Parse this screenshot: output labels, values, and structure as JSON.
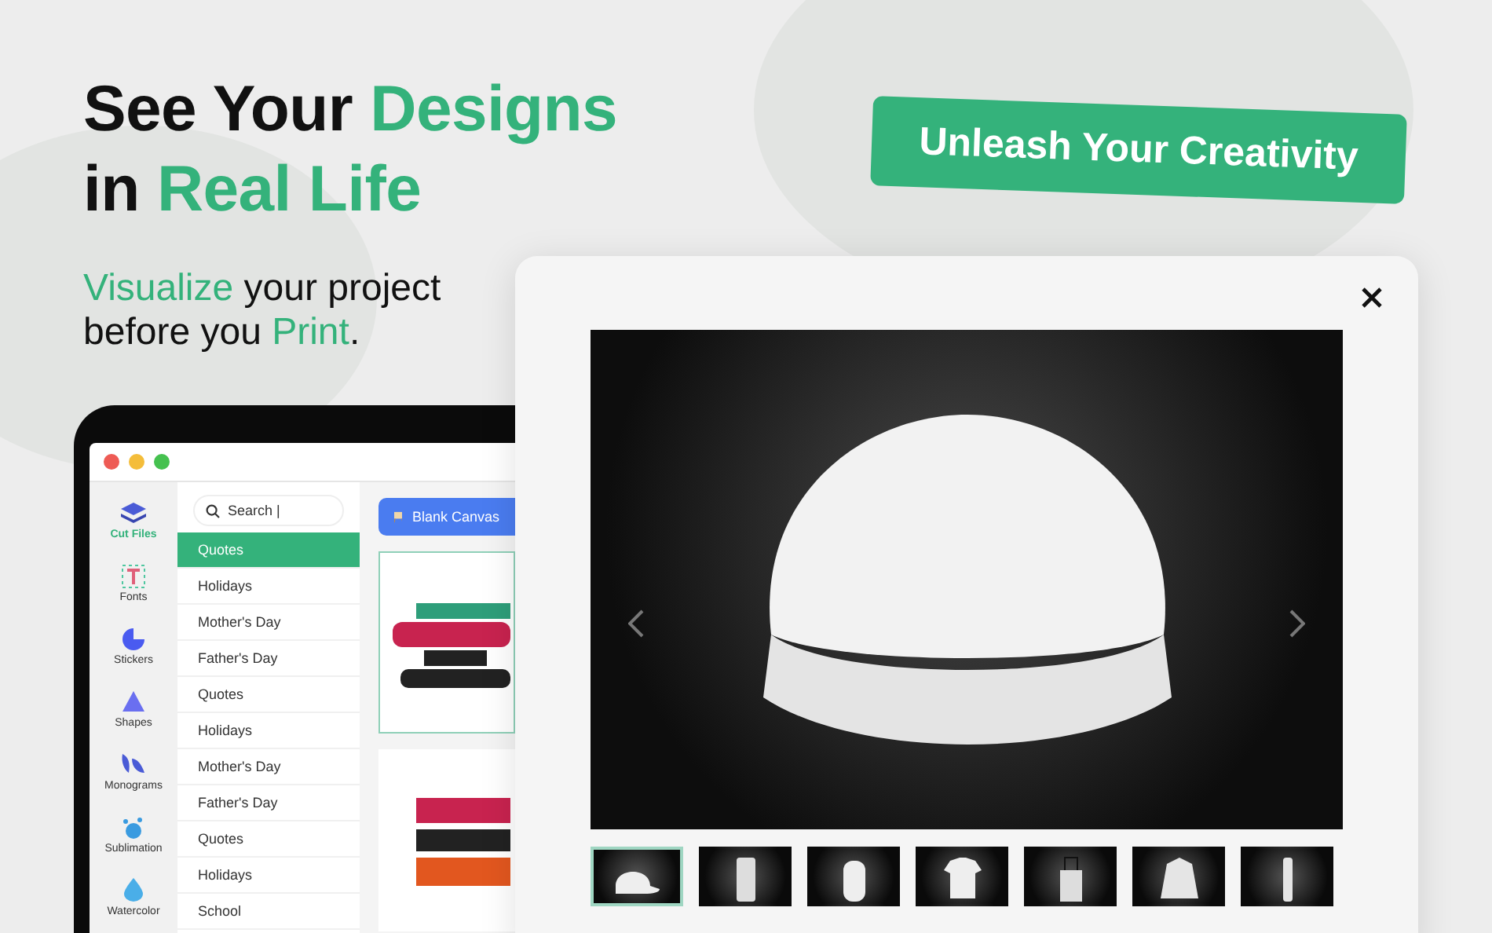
{
  "headline": {
    "lines": [
      [
        {
          "text": "See Your ",
          "highlight": false
        },
        {
          "text": "Designs",
          "highlight": true
        }
      ],
      [
        {
          "text": "in ",
          "highlight": false
        },
        {
          "text": "Real Life",
          "highlight": true
        }
      ]
    ]
  },
  "subtitle": {
    "lines": [
      [
        {
          "text": "Visualize",
          "highlight": true
        },
        {
          "text": " your project",
          "highlight": false
        }
      ],
      [
        {
          "text": "before you ",
          "highlight": false
        },
        {
          "text": "Print",
          "highlight": true
        },
        {
          "text": ".",
          "highlight": false
        }
      ]
    ]
  },
  "badge": "Unleash Your Creativity",
  "app_window": {
    "sidebar": [
      {
        "kind": "layers",
        "label": "Cut Files",
        "selected": true
      },
      {
        "kind": "fonts",
        "label": "Fonts",
        "selected": false
      },
      {
        "kind": "stickers",
        "label": "Stickers",
        "selected": false
      },
      {
        "kind": "shapes",
        "label": "Shapes",
        "selected": false
      },
      {
        "kind": "monograms",
        "label": "Monograms",
        "selected": false
      },
      {
        "kind": "sublimation",
        "label": "Sublimation",
        "selected": false
      },
      {
        "kind": "watercolor",
        "label": "Watercolor",
        "selected": false
      }
    ],
    "search": {
      "placeholder": "Search |"
    },
    "categories": [
      {
        "label": "Quotes",
        "selected": true
      },
      {
        "label": "Holidays",
        "selected": false
      },
      {
        "label": "Mother's Day",
        "selected": false
      },
      {
        "label": "Father's Day",
        "selected": false
      },
      {
        "label": "Quotes",
        "selected": false
      },
      {
        "label": "Holidays",
        "selected": false
      },
      {
        "label": "Mother's Day",
        "selected": false
      },
      {
        "label": "Father's Day",
        "selected": false
      },
      {
        "label": "Quotes",
        "selected": false
      },
      {
        "label": "Holidays",
        "selected": false
      },
      {
        "label": "School",
        "selected": false
      }
    ],
    "blank_canvas_button": "Blank Canvas",
    "designs": [
      {
        "selected": true
      },
      {
        "selected": false
      }
    ]
  },
  "preview": {
    "thumbnails": [
      {
        "kind": "cap",
        "selected": true
      },
      {
        "kind": "tumbler",
        "selected": false
      },
      {
        "kind": "backpack",
        "selected": false
      },
      {
        "kind": "tshirt",
        "selected": false
      },
      {
        "kind": "tote",
        "selected": false
      },
      {
        "kind": "hoodie",
        "selected": false
      },
      {
        "kind": "bottle",
        "selected": false
      }
    ]
  }
}
